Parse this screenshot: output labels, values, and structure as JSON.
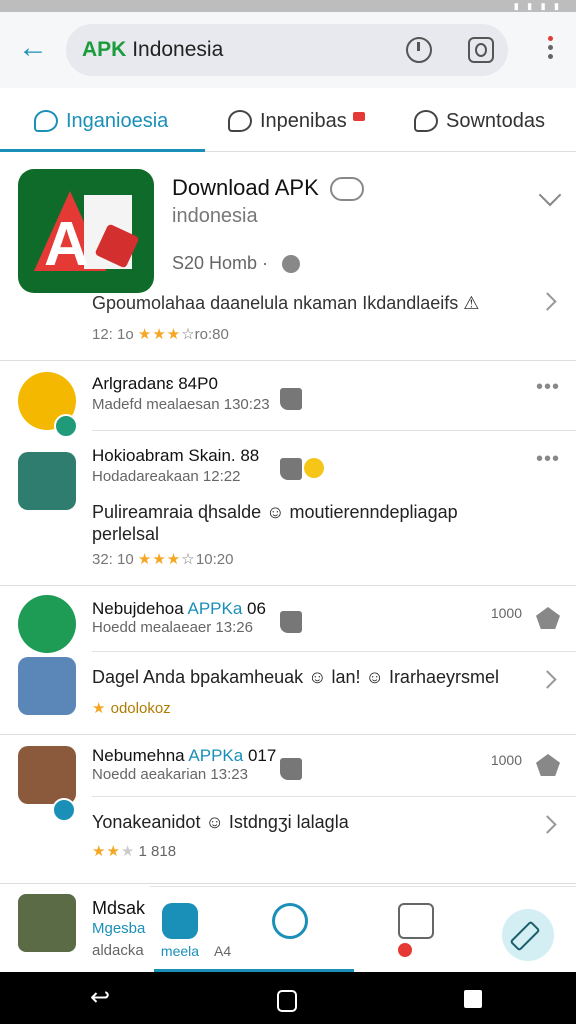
{
  "search": {
    "brand": "APK",
    "query": "Indonesia"
  },
  "tabs": [
    {
      "label": "Inganioesia"
    },
    {
      "label": "Inpenibas"
    },
    {
      "label": "Sowntodas"
    }
  ],
  "hero": {
    "title": "Download APK",
    "subtitle": "indonesia",
    "meta": "S20 Homb ·",
    "description": "Gpoumolahaa daanelula nkaman Ikdandlaeifs ⚠",
    "rating_num": "12: 1o",
    "rating_stars": "★★★",
    "rating_suffix": "☆ro:80"
  },
  "section1": {
    "row1": {
      "title": "Arlgradanɛ 84P0",
      "sub": "Madefd mealaesan 130:23",
      "more": "•••"
    },
    "row2": {
      "title": "Hokioabram Skain. 88",
      "sub": "Hodadareakaan 12:22",
      "more": "•••"
    },
    "body": "Pulireamraia ɖhsalde ☺ moutierenndepliagap",
    "body2": "perlelsal",
    "rating_num": "32: 10",
    "rating_stars": "★★★",
    "rating_suffix": "☆ 10:20"
  },
  "section2": {
    "row1": {
      "title_prefix": "Nebujdehoa ",
      "title_accent": "APPKa",
      "title_suffix": " 06",
      "sub": "Hoedd mealaeaer 13:26",
      "count": "1000"
    },
    "row2": {
      "title": "Dagel Anda bpakamheuak ☺ lan! ☺ Irarhaeyrsmel",
      "sub": "odolokoz"
    }
  },
  "section3": {
    "row1": {
      "title_prefix": "Nebumehna ",
      "title_accent": "APPKa",
      "title_suffix": " 017",
      "sub": "Noedd aeakarian 13:23",
      "count": "1000"
    },
    "row2": {
      "title": "Yonakeanidot ☺ Istdngʒi lalagla",
      "rating": "1 818"
    }
  },
  "last": {
    "title": "Mdsak",
    "sub_accent": "Mgesba",
    "sub": "aldacka"
  },
  "bottomnav": [
    {
      "label": "meela"
    },
    {
      "label": "A4"
    }
  ]
}
